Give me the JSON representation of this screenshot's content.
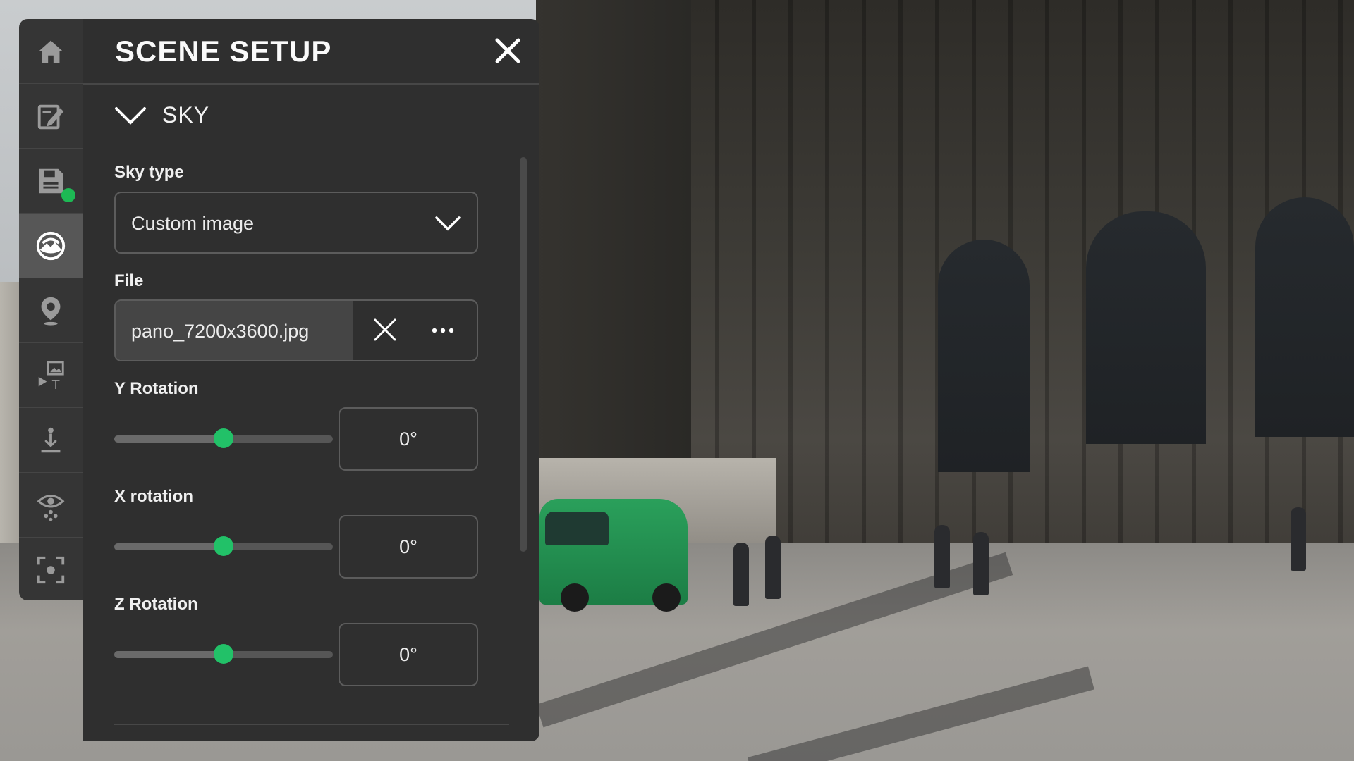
{
  "panel": {
    "title": "SCENE SETUP",
    "section": "SKY"
  },
  "rail": {
    "items": [
      {
        "icon": "home-icon",
        "active": false
      },
      {
        "icon": "edit-icon",
        "active": false
      },
      {
        "icon": "save-icon",
        "active": false,
        "status_dot_color": "#1db954"
      },
      {
        "icon": "sky-icon",
        "active": true
      },
      {
        "icon": "map-pin-icon",
        "active": false
      },
      {
        "icon": "media-text-icon",
        "active": false
      },
      {
        "icon": "ground-icon",
        "active": false
      },
      {
        "icon": "view-icon",
        "active": false
      },
      {
        "icon": "focus-icon",
        "active": false
      }
    ]
  },
  "sky_type": {
    "label": "Sky type",
    "value": "Custom image"
  },
  "file": {
    "label": "File",
    "value": "pano_7200x3600.jpg"
  },
  "rotations": [
    {
      "label": "Y Rotation",
      "value": "0°",
      "slider_fraction": 0.5
    },
    {
      "label": "X rotation",
      "value": "0°",
      "slider_fraction": 0.5
    },
    {
      "label": "Z Rotation",
      "value": "0°",
      "slider_fraction": 0.5
    }
  ],
  "colors": {
    "accent": "#22c168",
    "panel_bg": "#2f2f2f",
    "rail_bg": "#353535",
    "rail_active": "#575757"
  }
}
